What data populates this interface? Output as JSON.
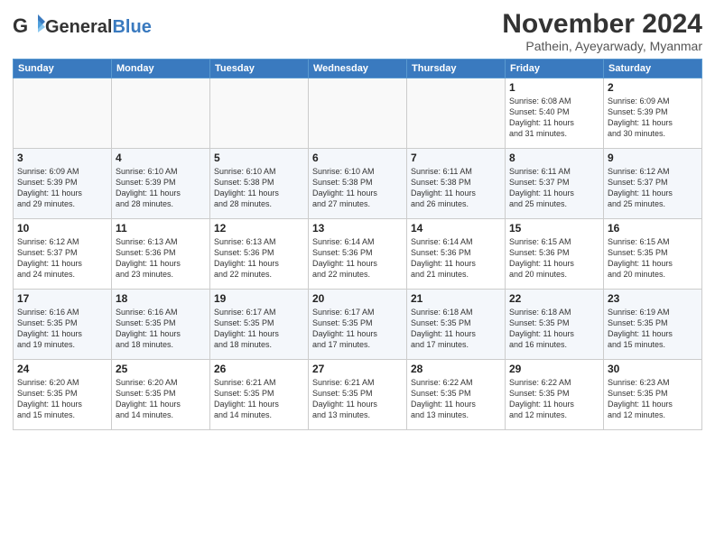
{
  "logo": {
    "general": "General",
    "blue": "Blue"
  },
  "header": {
    "month_title": "November 2024",
    "subtitle": "Pathein, Ayeyarwady, Myanmar"
  },
  "weekdays": [
    "Sunday",
    "Monday",
    "Tuesday",
    "Wednesday",
    "Thursday",
    "Friday",
    "Saturday"
  ],
  "weeks": [
    [
      {
        "day": "",
        "detail": ""
      },
      {
        "day": "",
        "detail": ""
      },
      {
        "day": "",
        "detail": ""
      },
      {
        "day": "",
        "detail": ""
      },
      {
        "day": "",
        "detail": ""
      },
      {
        "day": "1",
        "detail": "Sunrise: 6:08 AM\nSunset: 5:40 PM\nDaylight: 11 hours\nand 31 minutes."
      },
      {
        "day": "2",
        "detail": "Sunrise: 6:09 AM\nSunset: 5:39 PM\nDaylight: 11 hours\nand 30 minutes."
      }
    ],
    [
      {
        "day": "3",
        "detail": "Sunrise: 6:09 AM\nSunset: 5:39 PM\nDaylight: 11 hours\nand 29 minutes."
      },
      {
        "day": "4",
        "detail": "Sunrise: 6:10 AM\nSunset: 5:39 PM\nDaylight: 11 hours\nand 28 minutes."
      },
      {
        "day": "5",
        "detail": "Sunrise: 6:10 AM\nSunset: 5:38 PM\nDaylight: 11 hours\nand 28 minutes."
      },
      {
        "day": "6",
        "detail": "Sunrise: 6:10 AM\nSunset: 5:38 PM\nDaylight: 11 hours\nand 27 minutes."
      },
      {
        "day": "7",
        "detail": "Sunrise: 6:11 AM\nSunset: 5:38 PM\nDaylight: 11 hours\nand 26 minutes."
      },
      {
        "day": "8",
        "detail": "Sunrise: 6:11 AM\nSunset: 5:37 PM\nDaylight: 11 hours\nand 25 minutes."
      },
      {
        "day": "9",
        "detail": "Sunrise: 6:12 AM\nSunset: 5:37 PM\nDaylight: 11 hours\nand 25 minutes."
      }
    ],
    [
      {
        "day": "10",
        "detail": "Sunrise: 6:12 AM\nSunset: 5:37 PM\nDaylight: 11 hours\nand 24 minutes."
      },
      {
        "day": "11",
        "detail": "Sunrise: 6:13 AM\nSunset: 5:36 PM\nDaylight: 11 hours\nand 23 minutes."
      },
      {
        "day": "12",
        "detail": "Sunrise: 6:13 AM\nSunset: 5:36 PM\nDaylight: 11 hours\nand 22 minutes."
      },
      {
        "day": "13",
        "detail": "Sunrise: 6:14 AM\nSunset: 5:36 PM\nDaylight: 11 hours\nand 22 minutes."
      },
      {
        "day": "14",
        "detail": "Sunrise: 6:14 AM\nSunset: 5:36 PM\nDaylight: 11 hours\nand 21 minutes."
      },
      {
        "day": "15",
        "detail": "Sunrise: 6:15 AM\nSunset: 5:36 PM\nDaylight: 11 hours\nand 20 minutes."
      },
      {
        "day": "16",
        "detail": "Sunrise: 6:15 AM\nSunset: 5:35 PM\nDaylight: 11 hours\nand 20 minutes."
      }
    ],
    [
      {
        "day": "17",
        "detail": "Sunrise: 6:16 AM\nSunset: 5:35 PM\nDaylight: 11 hours\nand 19 minutes."
      },
      {
        "day": "18",
        "detail": "Sunrise: 6:16 AM\nSunset: 5:35 PM\nDaylight: 11 hours\nand 18 minutes."
      },
      {
        "day": "19",
        "detail": "Sunrise: 6:17 AM\nSunset: 5:35 PM\nDaylight: 11 hours\nand 18 minutes."
      },
      {
        "day": "20",
        "detail": "Sunrise: 6:17 AM\nSunset: 5:35 PM\nDaylight: 11 hours\nand 17 minutes."
      },
      {
        "day": "21",
        "detail": "Sunrise: 6:18 AM\nSunset: 5:35 PM\nDaylight: 11 hours\nand 17 minutes."
      },
      {
        "day": "22",
        "detail": "Sunrise: 6:18 AM\nSunset: 5:35 PM\nDaylight: 11 hours\nand 16 minutes."
      },
      {
        "day": "23",
        "detail": "Sunrise: 6:19 AM\nSunset: 5:35 PM\nDaylight: 11 hours\nand 15 minutes."
      }
    ],
    [
      {
        "day": "24",
        "detail": "Sunrise: 6:20 AM\nSunset: 5:35 PM\nDaylight: 11 hours\nand 15 minutes."
      },
      {
        "day": "25",
        "detail": "Sunrise: 6:20 AM\nSunset: 5:35 PM\nDaylight: 11 hours\nand 14 minutes."
      },
      {
        "day": "26",
        "detail": "Sunrise: 6:21 AM\nSunset: 5:35 PM\nDaylight: 11 hours\nand 14 minutes."
      },
      {
        "day": "27",
        "detail": "Sunrise: 6:21 AM\nSunset: 5:35 PM\nDaylight: 11 hours\nand 13 minutes."
      },
      {
        "day": "28",
        "detail": "Sunrise: 6:22 AM\nSunset: 5:35 PM\nDaylight: 11 hours\nand 13 minutes."
      },
      {
        "day": "29",
        "detail": "Sunrise: 6:22 AM\nSunset: 5:35 PM\nDaylight: 11 hours\nand 12 minutes."
      },
      {
        "day": "30",
        "detail": "Sunrise: 6:23 AM\nSunset: 5:35 PM\nDaylight: 11 hours\nand 12 minutes."
      }
    ]
  ]
}
